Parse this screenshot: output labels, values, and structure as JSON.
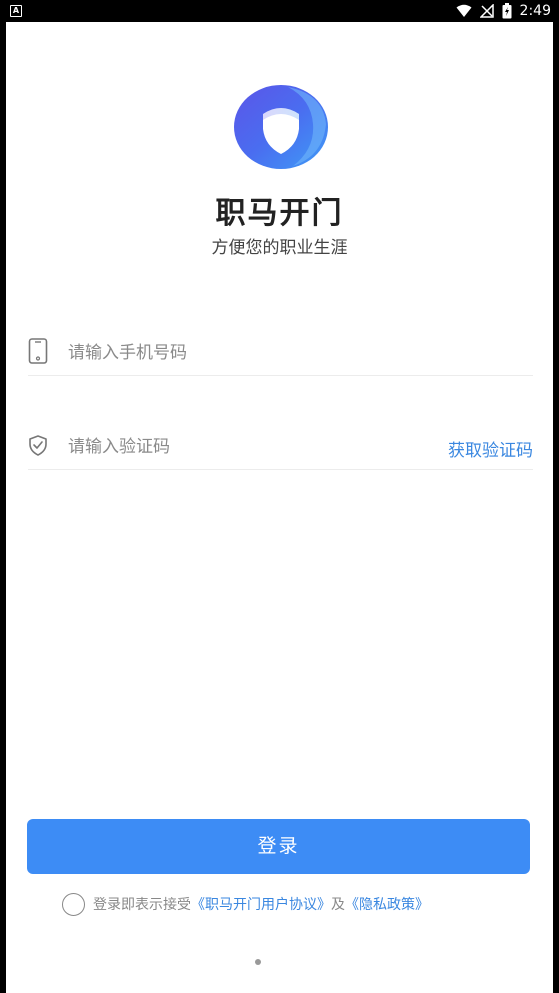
{
  "status_bar": {
    "left_icon": "A",
    "time": "2:49",
    "icons": [
      "wifi-icon",
      "signal-icon",
      "battery-icon"
    ]
  },
  "app": {
    "name": "职马开门",
    "slogan": "方便您的职业生涯"
  },
  "form": {
    "phone_placeholder": "请输入手机号码",
    "code_placeholder": "请输入验证码",
    "get_code_label": "获取验证码"
  },
  "login_label": "登录",
  "agreement": {
    "prefix": "登录即表示接受",
    "user_agreement": "《职马开门用户协议》",
    "conjunction": "及",
    "privacy_policy": "《隐私政策》"
  },
  "colors": {
    "accent": "#3d8cf5",
    "link": "#3a87e0"
  }
}
